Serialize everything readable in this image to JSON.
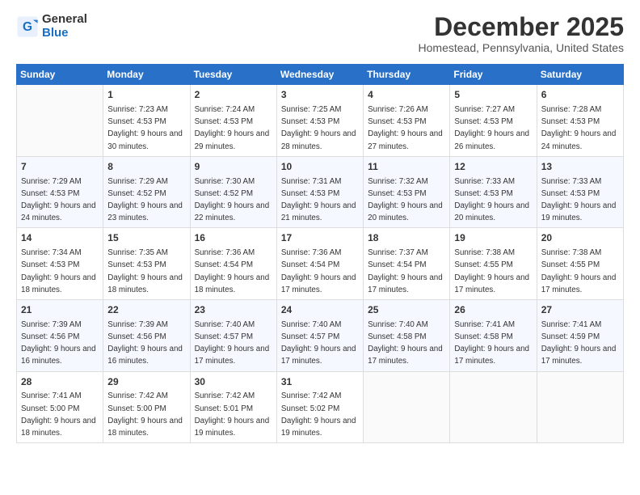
{
  "logo": {
    "general": "General",
    "blue": "Blue"
  },
  "title": {
    "month": "December 2025",
    "location": "Homestead, Pennsylvania, United States"
  },
  "weekdays": [
    "Sunday",
    "Monday",
    "Tuesday",
    "Wednesday",
    "Thursday",
    "Friday",
    "Saturday"
  ],
  "weeks": [
    [
      {
        "day": "",
        "sunrise": "",
        "sunset": "",
        "daylight": ""
      },
      {
        "day": "1",
        "sunrise": "Sunrise: 7:23 AM",
        "sunset": "Sunset: 4:53 PM",
        "daylight": "Daylight: 9 hours and 30 minutes."
      },
      {
        "day": "2",
        "sunrise": "Sunrise: 7:24 AM",
        "sunset": "Sunset: 4:53 PM",
        "daylight": "Daylight: 9 hours and 29 minutes."
      },
      {
        "day": "3",
        "sunrise": "Sunrise: 7:25 AM",
        "sunset": "Sunset: 4:53 PM",
        "daylight": "Daylight: 9 hours and 28 minutes."
      },
      {
        "day": "4",
        "sunrise": "Sunrise: 7:26 AM",
        "sunset": "Sunset: 4:53 PM",
        "daylight": "Daylight: 9 hours and 27 minutes."
      },
      {
        "day": "5",
        "sunrise": "Sunrise: 7:27 AM",
        "sunset": "Sunset: 4:53 PM",
        "daylight": "Daylight: 9 hours and 26 minutes."
      },
      {
        "day": "6",
        "sunrise": "Sunrise: 7:28 AM",
        "sunset": "Sunset: 4:53 PM",
        "daylight": "Daylight: 9 hours and 24 minutes."
      }
    ],
    [
      {
        "day": "7",
        "sunrise": "Sunrise: 7:29 AM",
        "sunset": "Sunset: 4:53 PM",
        "daylight": "Daylight: 9 hours and 24 minutes."
      },
      {
        "day": "8",
        "sunrise": "Sunrise: 7:29 AM",
        "sunset": "Sunset: 4:52 PM",
        "daylight": "Daylight: 9 hours and 23 minutes."
      },
      {
        "day": "9",
        "sunrise": "Sunrise: 7:30 AM",
        "sunset": "Sunset: 4:52 PM",
        "daylight": "Daylight: 9 hours and 22 minutes."
      },
      {
        "day": "10",
        "sunrise": "Sunrise: 7:31 AM",
        "sunset": "Sunset: 4:53 PM",
        "daylight": "Daylight: 9 hours and 21 minutes."
      },
      {
        "day": "11",
        "sunrise": "Sunrise: 7:32 AM",
        "sunset": "Sunset: 4:53 PM",
        "daylight": "Daylight: 9 hours and 20 minutes."
      },
      {
        "day": "12",
        "sunrise": "Sunrise: 7:33 AM",
        "sunset": "Sunset: 4:53 PM",
        "daylight": "Daylight: 9 hours and 20 minutes."
      },
      {
        "day": "13",
        "sunrise": "Sunrise: 7:33 AM",
        "sunset": "Sunset: 4:53 PM",
        "daylight": "Daylight: 9 hours and 19 minutes."
      }
    ],
    [
      {
        "day": "14",
        "sunrise": "Sunrise: 7:34 AM",
        "sunset": "Sunset: 4:53 PM",
        "daylight": "Daylight: 9 hours and 18 minutes."
      },
      {
        "day": "15",
        "sunrise": "Sunrise: 7:35 AM",
        "sunset": "Sunset: 4:53 PM",
        "daylight": "Daylight: 9 hours and 18 minutes."
      },
      {
        "day": "16",
        "sunrise": "Sunrise: 7:36 AM",
        "sunset": "Sunset: 4:54 PM",
        "daylight": "Daylight: 9 hours and 18 minutes."
      },
      {
        "day": "17",
        "sunrise": "Sunrise: 7:36 AM",
        "sunset": "Sunset: 4:54 PM",
        "daylight": "Daylight: 9 hours and 17 minutes."
      },
      {
        "day": "18",
        "sunrise": "Sunrise: 7:37 AM",
        "sunset": "Sunset: 4:54 PM",
        "daylight": "Daylight: 9 hours and 17 minutes."
      },
      {
        "day": "19",
        "sunrise": "Sunrise: 7:38 AM",
        "sunset": "Sunset: 4:55 PM",
        "daylight": "Daylight: 9 hours and 17 minutes."
      },
      {
        "day": "20",
        "sunrise": "Sunrise: 7:38 AM",
        "sunset": "Sunset: 4:55 PM",
        "daylight": "Daylight: 9 hours and 17 minutes."
      }
    ],
    [
      {
        "day": "21",
        "sunrise": "Sunrise: 7:39 AM",
        "sunset": "Sunset: 4:56 PM",
        "daylight": "Daylight: 9 hours and 16 minutes."
      },
      {
        "day": "22",
        "sunrise": "Sunrise: 7:39 AM",
        "sunset": "Sunset: 4:56 PM",
        "daylight": "Daylight: 9 hours and 16 minutes."
      },
      {
        "day": "23",
        "sunrise": "Sunrise: 7:40 AM",
        "sunset": "Sunset: 4:57 PM",
        "daylight": "Daylight: 9 hours and 17 minutes."
      },
      {
        "day": "24",
        "sunrise": "Sunrise: 7:40 AM",
        "sunset": "Sunset: 4:57 PM",
        "daylight": "Daylight: 9 hours and 17 minutes."
      },
      {
        "day": "25",
        "sunrise": "Sunrise: 7:40 AM",
        "sunset": "Sunset: 4:58 PM",
        "daylight": "Daylight: 9 hours and 17 minutes."
      },
      {
        "day": "26",
        "sunrise": "Sunrise: 7:41 AM",
        "sunset": "Sunset: 4:58 PM",
        "daylight": "Daylight: 9 hours and 17 minutes."
      },
      {
        "day": "27",
        "sunrise": "Sunrise: 7:41 AM",
        "sunset": "Sunset: 4:59 PM",
        "daylight": "Daylight: 9 hours and 17 minutes."
      }
    ],
    [
      {
        "day": "28",
        "sunrise": "Sunrise: 7:41 AM",
        "sunset": "Sunset: 5:00 PM",
        "daylight": "Daylight: 9 hours and 18 minutes."
      },
      {
        "day": "29",
        "sunrise": "Sunrise: 7:42 AM",
        "sunset": "Sunset: 5:00 PM",
        "daylight": "Daylight: 9 hours and 18 minutes."
      },
      {
        "day": "30",
        "sunrise": "Sunrise: 7:42 AM",
        "sunset": "Sunset: 5:01 PM",
        "daylight": "Daylight: 9 hours and 19 minutes."
      },
      {
        "day": "31",
        "sunrise": "Sunrise: 7:42 AM",
        "sunset": "Sunset: 5:02 PM",
        "daylight": "Daylight: 9 hours and 19 minutes."
      },
      {
        "day": "",
        "sunrise": "",
        "sunset": "",
        "daylight": ""
      },
      {
        "day": "",
        "sunrise": "",
        "sunset": "",
        "daylight": ""
      },
      {
        "day": "",
        "sunrise": "",
        "sunset": "",
        "daylight": ""
      }
    ]
  ]
}
